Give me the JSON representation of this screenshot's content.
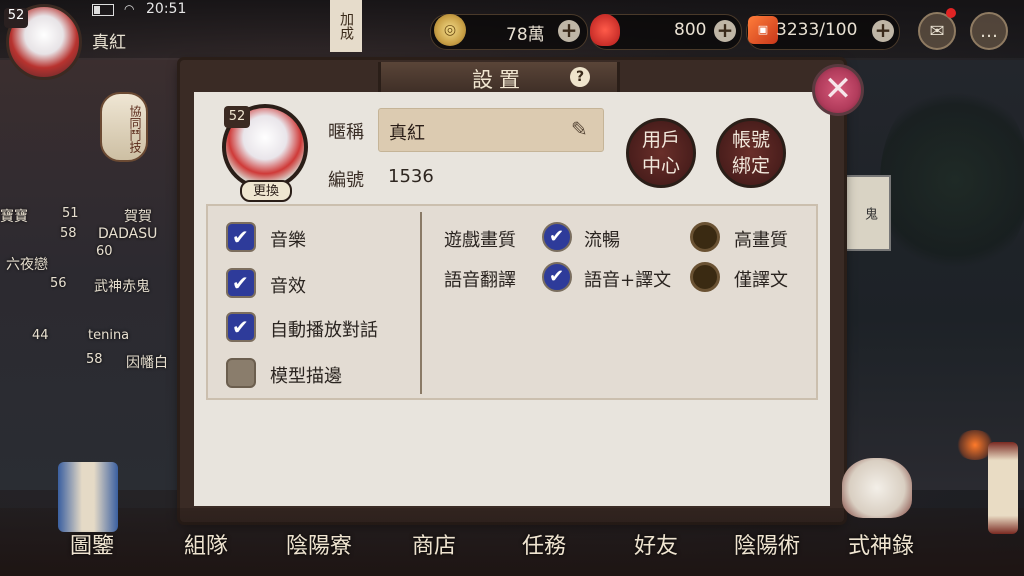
{
  "status_bar": {
    "time": "20:51"
  },
  "player": {
    "level": "52",
    "name": "真紅"
  },
  "top_banner": "加成",
  "resources": {
    "coins": {
      "value": "78萬"
    },
    "jade": {
      "value": "800"
    },
    "stamina": {
      "value": "3233/100"
    }
  },
  "background": {
    "lantern": "協同鬥技",
    "sign": "鬼",
    "players": [
      {
        "name": "寶寶",
        "level": "51"
      },
      {
        "name": "賀賀",
        "level": ""
      },
      {
        "name": "DADASU",
        "level": "58"
      },
      {
        "name": "六夜戀",
        "level": "60"
      },
      {
        "name": "武神赤鬼",
        "level": "56"
      },
      {
        "name": "tenina",
        "level": "44"
      },
      {
        "name": "因幡白",
        "level": "58"
      }
    ]
  },
  "dialog": {
    "title": "設置",
    "profile": {
      "level": "52",
      "change_label": "更換",
      "nickname_label": "暱稱",
      "nickname_value": "真紅",
      "id_label": "編號",
      "id_value": "1536",
      "user_center_label": "用戶\n中心",
      "account_bind_label": "帳號\n綁定"
    },
    "options": {
      "music": {
        "label": "音樂",
        "checked": true
      },
      "sfx": {
        "label": "音效",
        "checked": true
      },
      "auto_dialog": {
        "label": "自動播放對話",
        "checked": true
      },
      "model_outline": {
        "label": "模型描邊",
        "checked": false
      }
    },
    "quality": {
      "label": "遊戲畫質",
      "options": [
        {
          "label": "流暢",
          "selected": true
        },
        {
          "label": "高畫質",
          "selected": false
        }
      ]
    },
    "voice": {
      "label": "語音翻譯",
      "options": [
        {
          "label": "語音+譯文",
          "selected": true
        },
        {
          "label": "僅譯文",
          "selected": false
        }
      ]
    }
  },
  "bottom_nav": [
    "圖鑒",
    "組隊",
    "陰陽寮",
    "商店",
    "任務",
    "好友",
    "陰陽術",
    "式神錄"
  ]
}
